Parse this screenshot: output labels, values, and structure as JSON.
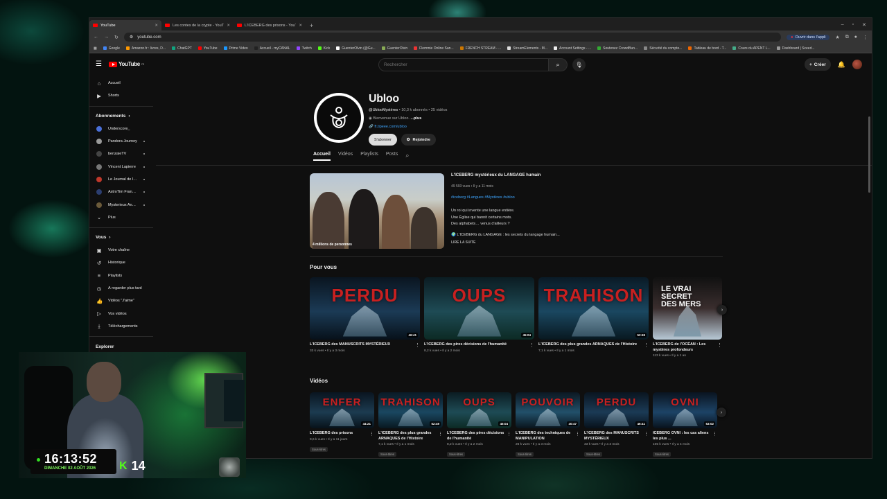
{
  "browser": {
    "tabs": [
      {
        "title": "YouTube",
        "active": true
      },
      {
        "title": "Les contes de la crypte - YouTu"
      },
      {
        "title": "L'ICEBERG des prisons - YouTu"
      }
    ],
    "url": "youtube.com",
    "open_app": "Ouvrir dans l'appli",
    "bookmarks": [
      "Google",
      "Amazon.fr : livres, D...",
      "ChatGPT",
      "YouTube",
      "Prime Video",
      "Accueil - myCANAL",
      "Twitch",
      "Kick",
      "GuenterOlvin (@Gu...",
      "GuenterOlvin",
      "Flemmie Online San...",
      "FRENCH STREAM - ...",
      "StreamElements - M...",
      "Account Settings - ...",
      "Soutenez CrowdBun...",
      "Sécurité du compte...",
      "Tableau de bord - T...",
      "Cours du APENT L...",
      "Dashboard | Sceed..."
    ]
  },
  "masthead": {
    "logo": "YouTube",
    "logo_region": "FR",
    "search_placeholder": "Rechercher",
    "create_label": "Créer"
  },
  "sidebar": {
    "main": [
      {
        "label": "Accueil",
        "icon": "home-icon"
      },
      {
        "label": "Shorts",
        "icon": "shorts-icon"
      }
    ],
    "subs_title": "Abonnements",
    "subs": [
      {
        "label": "Underscore_",
        "color": "#4a6fd8",
        "dot": false
      },
      {
        "label": "Pandora Journey",
        "color": "#9a9a9a",
        "dot": true
      },
      {
        "label": "benzaieTV",
        "color": "#444",
        "dot": true
      },
      {
        "label": "Vincent Lapierre",
        "color": "#777",
        "dot": true
      },
      {
        "label": "Le Journal de l'E...",
        "color": "#c0382b",
        "dot": true
      },
      {
        "label": "AstroTim Français",
        "color": "#2c3e70",
        "dot": true
      },
      {
        "label": "Mysterieux Anci...",
        "color": "#6b5a3a",
        "dot": true
      },
      {
        "label": "Plus",
        "color": "",
        "dot": false
      }
    ],
    "you_title": "Vous",
    "you": [
      {
        "label": "Votre chaîne",
        "icon": "channel-icon"
      },
      {
        "label": "Historique",
        "icon": "history-icon"
      },
      {
        "label": "Playlists",
        "icon": "playlists-icon"
      },
      {
        "label": "À regarder plus tard",
        "icon": "watch-later-icon"
      },
      {
        "label": "Vidéos \"J'aime\"",
        "icon": "like-icon"
      },
      {
        "label": "Vos vidéos",
        "icon": "your-videos-icon"
      },
      {
        "label": "Téléchargements",
        "icon": "download-icon"
      }
    ],
    "explore_title": "Explorer"
  },
  "channel": {
    "name": "Ubloo",
    "handle": "@UblooMystères",
    "subs": "10,3 k abonnés",
    "videos": "25 vidéos",
    "desc": "Bienvenue sur Ubloo.",
    "desc_more": "...plus",
    "link": "ft.tipeee.com/ubloo",
    "subscribe": "S'abonner",
    "join": "Rejoindre",
    "tabs": [
      "Accueil",
      "Vidéos",
      "Playlists",
      "Posts"
    ]
  },
  "featured": {
    "title": "L'ICEBERG mystérieux du LANGAGE humain",
    "meta": "49 593 vues • Il y a 11 mois",
    "tags": "#iceberg #Langues #Mystères #ubloo",
    "desc": [
      "Un roi qui invente une langue entière.",
      "Une Église qui bannit certains mots.",
      "Des alphabets… venus d'ailleurs ?"
    ],
    "line": "🌍 L'ICEBERG du LANGAGE : les secrets du langage humain...",
    "more": "LIRE LA SUITE",
    "thumb_caption": "4 millions de personnes"
  },
  "for_you": {
    "title": "Pour vous",
    "cards": [
      {
        "word": "PERDU",
        "dur": "46:41",
        "title": "L'ICEBERG des MANUSCRITS MYSTÉRIEUX",
        "meta": "33 k vues • Il y a 3 mois",
        "bg": "linear-gradient(180deg,#0a1520 0%,#1b3a55 55%,#07111a 100%)"
      },
      {
        "word": "OUPS",
        "dur": "45:04",
        "title": "L'ICEBERG des pires décisions de l'humanité",
        "meta": "8,2 k vues • Il y a 2 mois",
        "bg": "linear-gradient(180deg,#0b1c22 0%,#1e4b55 55%,#0c2a24 100%)"
      },
      {
        "word": "TRAHISON",
        "dur": "52:49",
        "title": "L'ICEBERG des plus grandes ARNAQUES de l'Histoire",
        "meta": "7,1 k vues • Il y a 1 mois",
        "bg": "linear-gradient(180deg,#0a1a26 0%,#1a4760 55%,#081820 100%)"
      },
      {
        "word": "",
        "dur": "",
        "title": "L'ICEBERG de l'OCÉAN : Les mystères profondeurs",
        "meta": "113 k vues • Il y a 1 an",
        "bg": "linear-gradient(180deg,#111 0%,#3a2e2e 50%,#b8c9d6 100%)"
      }
    ],
    "ocean_title": "LE VRAI SECRET DES MERS"
  },
  "videos": {
    "title": "Vidéos",
    "badge": "Sous-titres",
    "cards": [
      {
        "word": "ENFER",
        "dur": "44:21",
        "title": "L'ICEBERG des prisons",
        "meta": "9,6 k vues • Il y a 11 jours",
        "bg": "linear-gradient(180deg,#0a1520 0%,#1c3b50 55%,#07121a 100%)"
      },
      {
        "word": "TRAHISON",
        "dur": "52:49",
        "title": "L'ICEBERG des plus grandes ARNAQUES de l'Histoire",
        "meta": "7,1 k vues • Il y a 1 mois",
        "bg": "linear-gradient(180deg,#0a1a26 0%,#1a4760 55%,#081820 100%)"
      },
      {
        "word": "OUPS",
        "dur": "45:04",
        "title": "L'ICEBERG des pires décisions de l'humanité",
        "meta": "8,2 k vues • Il y a 2 mois",
        "bg": "linear-gradient(180deg,#0b1c22 0%,#1e4b55 55%,#0c2a24 100%)"
      },
      {
        "word": "POUVOIR",
        "dur": "40:47",
        "title": "L'ICEBERG des techniques de MANIPULATION",
        "meta": "26 k vues • Il y a 3 mois",
        "bg": "linear-gradient(180deg,#0c1822 0%,#22506a 55%,#09141c 100%)"
      },
      {
        "word": "PERDU",
        "dur": "46:41",
        "title": "L'ICEBERG des MANUSCRITS MYSTÉRIEUX",
        "meta": "33 k vues • Il y a 3 mois",
        "bg": "linear-gradient(180deg,#0a1520 0%,#1b3a55 55%,#07111a 100%)"
      },
      {
        "word": "OVNI",
        "dur": "53:02",
        "title": "ICEBERG OVNI : les cas aliens les plus ...",
        "meta": "105 k vues • Il y a 4 mois",
        "bg": "linear-gradient(180deg,#0a1420 0%,#1d4366 55%,#08121c 100%)"
      }
    ]
  },
  "overlay": {
    "time": "16:13:52",
    "date": "DIMANCHE 02 AOÛT 2026",
    "kick_logo": "K",
    "viewers": "14"
  }
}
